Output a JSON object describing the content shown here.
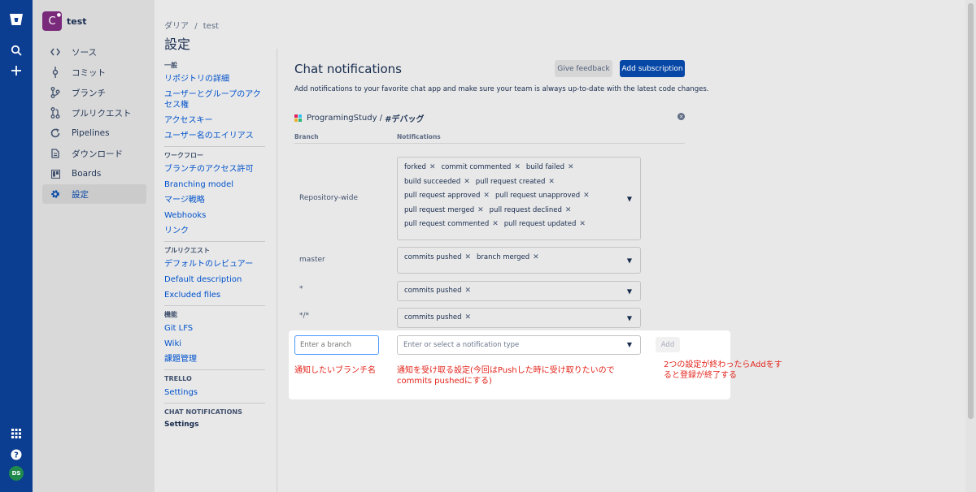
{
  "global_nav": {
    "icons": [
      "bitbucket-logo-icon",
      "search-icon",
      "plus-icon",
      "app-switcher-icon",
      "help-icon"
    ],
    "user_initials": "DS",
    "brand_color": "#0b3d91"
  },
  "project": {
    "avatar_letter": "C",
    "name": "test"
  },
  "sidebar": {
    "items": [
      {
        "label": "ソース",
        "icon": "code-icon"
      },
      {
        "label": "コミット",
        "icon": "commit-icon"
      },
      {
        "label": "ブランチ",
        "icon": "branch-icon"
      },
      {
        "label": "プルリクエスト",
        "icon": "pull-request-icon"
      },
      {
        "label": "Pipelines",
        "icon": "pipelines-icon"
      },
      {
        "label": "ダウンロード",
        "icon": "download-icon"
      },
      {
        "label": "Boards",
        "icon": "boards-icon"
      },
      {
        "label": "設定",
        "icon": "gear-icon",
        "active": true
      }
    ]
  },
  "header": {
    "breadcrumb_parent": "ダリア",
    "breadcrumb_sep": "/",
    "breadcrumb_current": "test",
    "title": "設定"
  },
  "settings_nav": {
    "sec1": "一般",
    "l1_1": "リポジトリの詳細",
    "l1_2": "ユーザーとグループのアクセス権",
    "l1_3": "アクセスキー",
    "l1_4": "ユーザー名のエイリアス",
    "sec2": "ワークフロー",
    "l2_1": "ブランチのアクセス許可",
    "l2_2": "Branching model",
    "l2_3": "マージ戦略",
    "l2_4": "Webhooks",
    "l2_5": "リンク",
    "sec3": "プルリクエスト",
    "l3_1": "デフォルトのレビュアー",
    "l3_2": "Default description",
    "l3_3": "Excluded files",
    "sec4": "機能",
    "l4_1": "Git LFS",
    "l4_2": "Wiki",
    "l4_3": "課題管理",
    "sec5": "TRELLO",
    "l5_1": "Settings",
    "sec6": "CHAT NOTIFICATIONS",
    "l6_1": "Settings"
  },
  "main": {
    "title": "Chat notifications",
    "feedback_label": "Give feedback",
    "add_subscription_label": "Add subscription",
    "description": "Add notifications to your favorite chat app and make sure your team is always up-to-date with the latest code changes.",
    "workspace": "ProgramingStudy /",
    "channel": "#デバッグ",
    "col_branch": "Branch",
    "col_notifications": "Notifications",
    "rows": [
      {
        "branch": "Repository-wide",
        "tags": [
          "forked",
          "commit commented",
          "build failed",
          "build succeeded",
          "pull request created",
          "pull request approved",
          "pull request unapproved",
          "pull request merged",
          "pull request declined",
          "pull request commented",
          "pull request updated"
        ]
      },
      {
        "branch": "master",
        "tags": [
          "commits pushed",
          "branch merged"
        ]
      },
      {
        "branch": "*",
        "tags": [
          "commits pushed"
        ]
      },
      {
        "branch": "*/*",
        "tags": [
          "commits pushed"
        ]
      }
    ],
    "branch_placeholder": "Enter a branch",
    "notif_placeholder": "Enter or select a notification type",
    "add_label": "Add"
  },
  "annotations": {
    "a1": "通知したいブランチ名",
    "a2_line1": "通知を受け取る設定(今回はPushした時に受け取りたいので",
    "a2_line2": "commits pushedにする)",
    "a3_line1": "2つの設定が終わったらAddをす",
    "a3_line2": "ると登録が終了する",
    "color": "#e3241b"
  }
}
